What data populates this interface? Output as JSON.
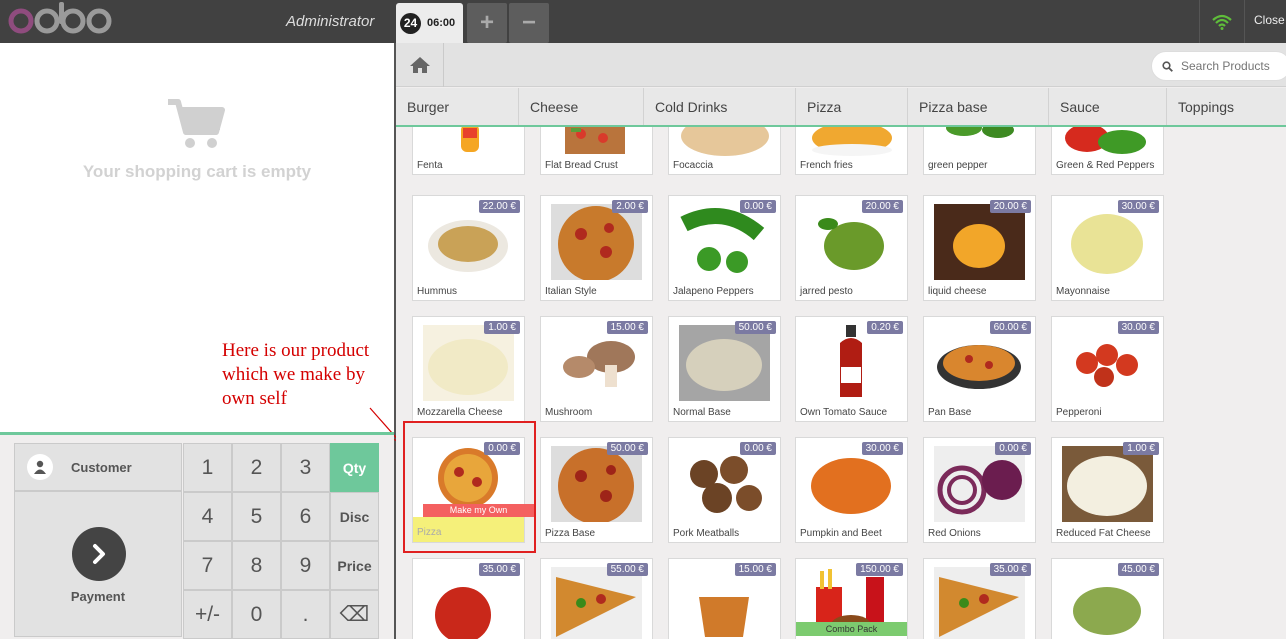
{
  "topbar": {
    "brand": "odoo",
    "user": "Administrator",
    "order_number": "24",
    "order_time": "06:00",
    "add_label": "+",
    "remove_label": "−",
    "close_label": "Close",
    "wifi_color": "#5fbd3a"
  },
  "cart": {
    "empty_text": "Your shopping cart is empty"
  },
  "annotation": {
    "text": "Here is our product which we make by own self",
    "color": "#d40000"
  },
  "numpad": {
    "customer_label": "Customer",
    "payment_label": "Payment",
    "keys": [
      "1",
      "2",
      "3",
      "4",
      "5",
      "6",
      "7",
      "8",
      "9",
      "+/-",
      "0",
      "."
    ],
    "modes": [
      "Qty",
      "Disc",
      "Price"
    ],
    "backspace": "⌫",
    "active_mode": "Qty",
    "accent": "#6ec89b"
  },
  "search": {
    "placeholder": "Search Products"
  },
  "categories": [
    "Burger",
    "Cheese",
    "Cold Drinks",
    "Pizza",
    "Pizza base",
    "Sauce",
    "Toppings"
  ],
  "products": {
    "row0": [
      {
        "name": "Fenta"
      },
      {
        "name": "Flat Bread Crust"
      },
      {
        "name": "Focaccia"
      },
      {
        "name": "French fries"
      },
      {
        "name": "green pepper"
      },
      {
        "name": "Green & Red Peppers"
      }
    ],
    "row1": [
      {
        "name": "Hummus",
        "price": "22.00 €"
      },
      {
        "name": "Italian Style",
        "price": "2.00 €"
      },
      {
        "name": "Jalapeno Peppers",
        "price": "0.00 €"
      },
      {
        "name": "jarred pesto",
        "price": "20.00 €"
      },
      {
        "name": "liquid cheese",
        "price": "20.00 €"
      },
      {
        "name": "Mayonnaise",
        "price": "30.00 €"
      }
    ],
    "row2": [
      {
        "name": "Mozzarella Cheese",
        "price": "1.00 €"
      },
      {
        "name": "Mushroom",
        "price": "15.00 €"
      },
      {
        "name": "Normal Base",
        "price": "50.00 €"
      },
      {
        "name": "Own Tomato Sauce",
        "price": "0.20 €"
      },
      {
        "name": "Pan Base",
        "price": "60.00 €"
      },
      {
        "name": "Pepperoni",
        "price": "30.00 €"
      }
    ],
    "row3": [
      {
        "name": "Pizza",
        "price": "0.00 €",
        "badge": "Make my Own"
      },
      {
        "name": "Pizza Base",
        "price": "50.00 €"
      },
      {
        "name": "Pork Meatballs",
        "price": "0.00 €"
      },
      {
        "name": "Pumpkin and Beet",
        "price": "30.00 €"
      },
      {
        "name": "Red Onions",
        "price": "0.00 €"
      },
      {
        "name": "Reduced Fat Cheese",
        "price": "1.00 €"
      }
    ],
    "row4": [
      {
        "price": "35.00 €"
      },
      {
        "price": "55.00 €"
      },
      {
        "price": "15.00 €"
      },
      {
        "price": "150.00 €",
        "badge": "Combo Pack"
      },
      {
        "price": "35.00 €"
      },
      {
        "price": "45.00 €"
      }
    ]
  }
}
